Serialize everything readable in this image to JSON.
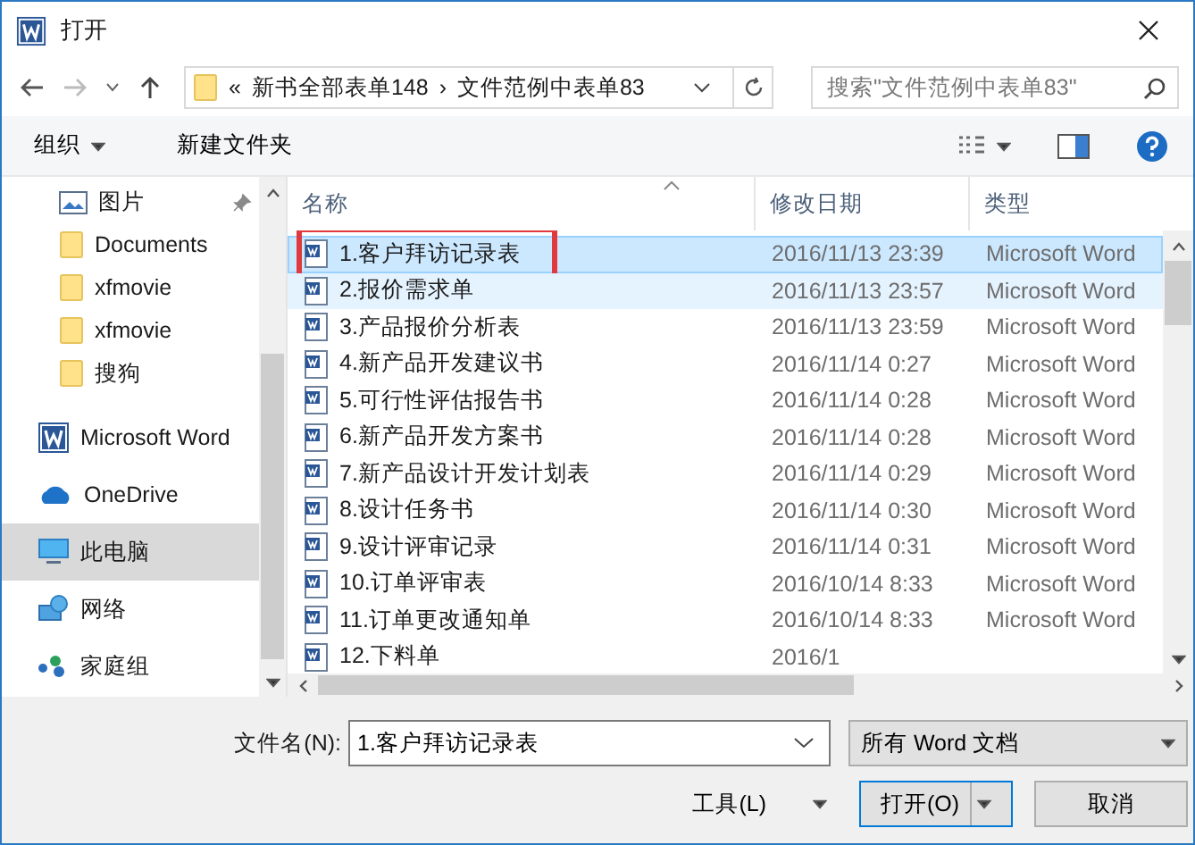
{
  "window": {
    "title": "打开"
  },
  "address": {
    "overflow": "«",
    "crumbs": [
      "新书全部表单148",
      "文件范例中表单83"
    ],
    "separator": "›"
  },
  "search": {
    "placeholder": "搜索\"文件范例中表单83\""
  },
  "toolbar": {
    "organize": "组织",
    "new_folder": "新建文件夹"
  },
  "sidebar": {
    "pinned_items": [
      {
        "label": "图片",
        "kind": "pictures",
        "pinned": true,
        "selected": false
      },
      {
        "label": "Documents",
        "kind": "folder",
        "pinned": false,
        "selected": false
      },
      {
        "label": "xfmovie",
        "kind": "folder",
        "pinned": false,
        "selected": false
      },
      {
        "label": "xfmovie",
        "kind": "folder",
        "pinned": false,
        "selected": false
      },
      {
        "label": "搜狗",
        "kind": "folder",
        "pinned": false,
        "selected": false
      }
    ],
    "locations": [
      {
        "label": "Microsoft Word",
        "kind": "word",
        "selected": false
      },
      {
        "label": "OneDrive",
        "kind": "cloud",
        "selected": false
      },
      {
        "label": "此电脑",
        "kind": "computer",
        "selected": true
      },
      {
        "label": "网络",
        "kind": "network",
        "selected": false
      },
      {
        "label": "家庭组",
        "kind": "homegroup",
        "selected": false
      }
    ]
  },
  "table": {
    "columns": [
      "名称",
      "修改日期",
      "类型"
    ],
    "rows": [
      {
        "name": "1.客户拜访记录表",
        "date": "2016/11/13 23:39",
        "type": "Microsoft Word",
        "selected": true,
        "hovered": false,
        "highlighted": true
      },
      {
        "name": "2.报价需求单",
        "date": "2016/11/13 23:57",
        "type": "Microsoft Word",
        "selected": false,
        "hovered": true,
        "highlighted": false
      },
      {
        "name": "3.产品报价分析表",
        "date": "2016/11/13 23:59",
        "type": "Microsoft Word",
        "selected": false,
        "hovered": false,
        "highlighted": false
      },
      {
        "name": "4.新产品开发建议书",
        "date": "2016/11/14 0:27",
        "type": "Microsoft Word",
        "selected": false,
        "hovered": false,
        "highlighted": false
      },
      {
        "name": "5.可行性评估报告书",
        "date": "2016/11/14 0:28",
        "type": "Microsoft Word",
        "selected": false,
        "hovered": false,
        "highlighted": false
      },
      {
        "name": "6.新产品开发方案书",
        "date": "2016/11/14 0:28",
        "type": "Microsoft Word",
        "selected": false,
        "hovered": false,
        "highlighted": false
      },
      {
        "name": "7.新产品设计开发计划表",
        "date": "2016/11/14 0:29",
        "type": "Microsoft Word",
        "selected": false,
        "hovered": false,
        "highlighted": false
      },
      {
        "name": "8.设计任务书",
        "date": "2016/11/14 0:30",
        "type": "Microsoft Word",
        "selected": false,
        "hovered": false,
        "highlighted": false
      },
      {
        "name": "9.设计评审记录",
        "date": "2016/11/14 0:31",
        "type": "Microsoft Word",
        "selected": false,
        "hovered": false,
        "highlighted": false
      },
      {
        "name": "10.订单评审表",
        "date": "2016/10/14 8:33",
        "type": "Microsoft Word",
        "selected": false,
        "hovered": false,
        "highlighted": false
      },
      {
        "name": "11.订单更改通知单",
        "date": "2016/10/14 8:33",
        "type": "Microsoft Word",
        "selected": false,
        "hovered": false,
        "highlighted": false
      },
      {
        "name": "12.下料单",
        "date": "2016/1",
        "selected": false,
        "hovered": false,
        "highlighted": false
      }
    ]
  },
  "footer": {
    "filename_label": "文件名(N):",
    "filename": "1.客户拜访记录表",
    "filter": "所有 Word 文档",
    "tools": "工具(L)",
    "open": "打开(O)",
    "cancel": "取消"
  }
}
